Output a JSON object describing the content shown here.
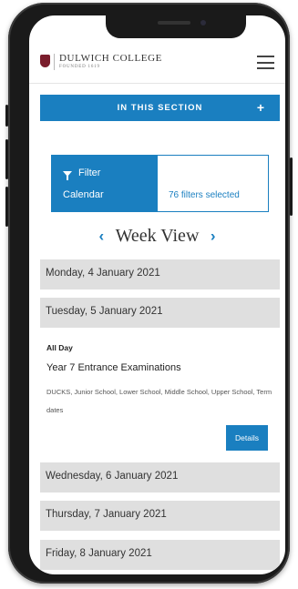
{
  "header": {
    "brand_name": "DULWICH COLLEGE",
    "brand_sub": "FOUNDED 1619"
  },
  "section_bar": {
    "label": "IN THIS SECTION",
    "toggle": "+"
  },
  "filter": {
    "title": "Filter",
    "subtitle": "Calendar",
    "count_text": "76 filters selected"
  },
  "week": {
    "title": "Week View",
    "prev": "‹",
    "next": "›"
  },
  "days": [
    "Monday, 4 January 2021",
    "Tuesday, 5 January 2021",
    "Wednesday, 6 January 2021",
    "Thursday, 7 January 2021",
    "Friday, 8 January 2021"
  ],
  "event": {
    "time": "All Day",
    "title": "Year 7 Entrance Examinations",
    "tags": "DUCKS, Junior School, Lower School, Middle School, Upper School, Term dates",
    "details_label": "Details"
  },
  "colors": {
    "accent": "#1a7fc0",
    "day_row_bg": "#dfdfdf"
  }
}
